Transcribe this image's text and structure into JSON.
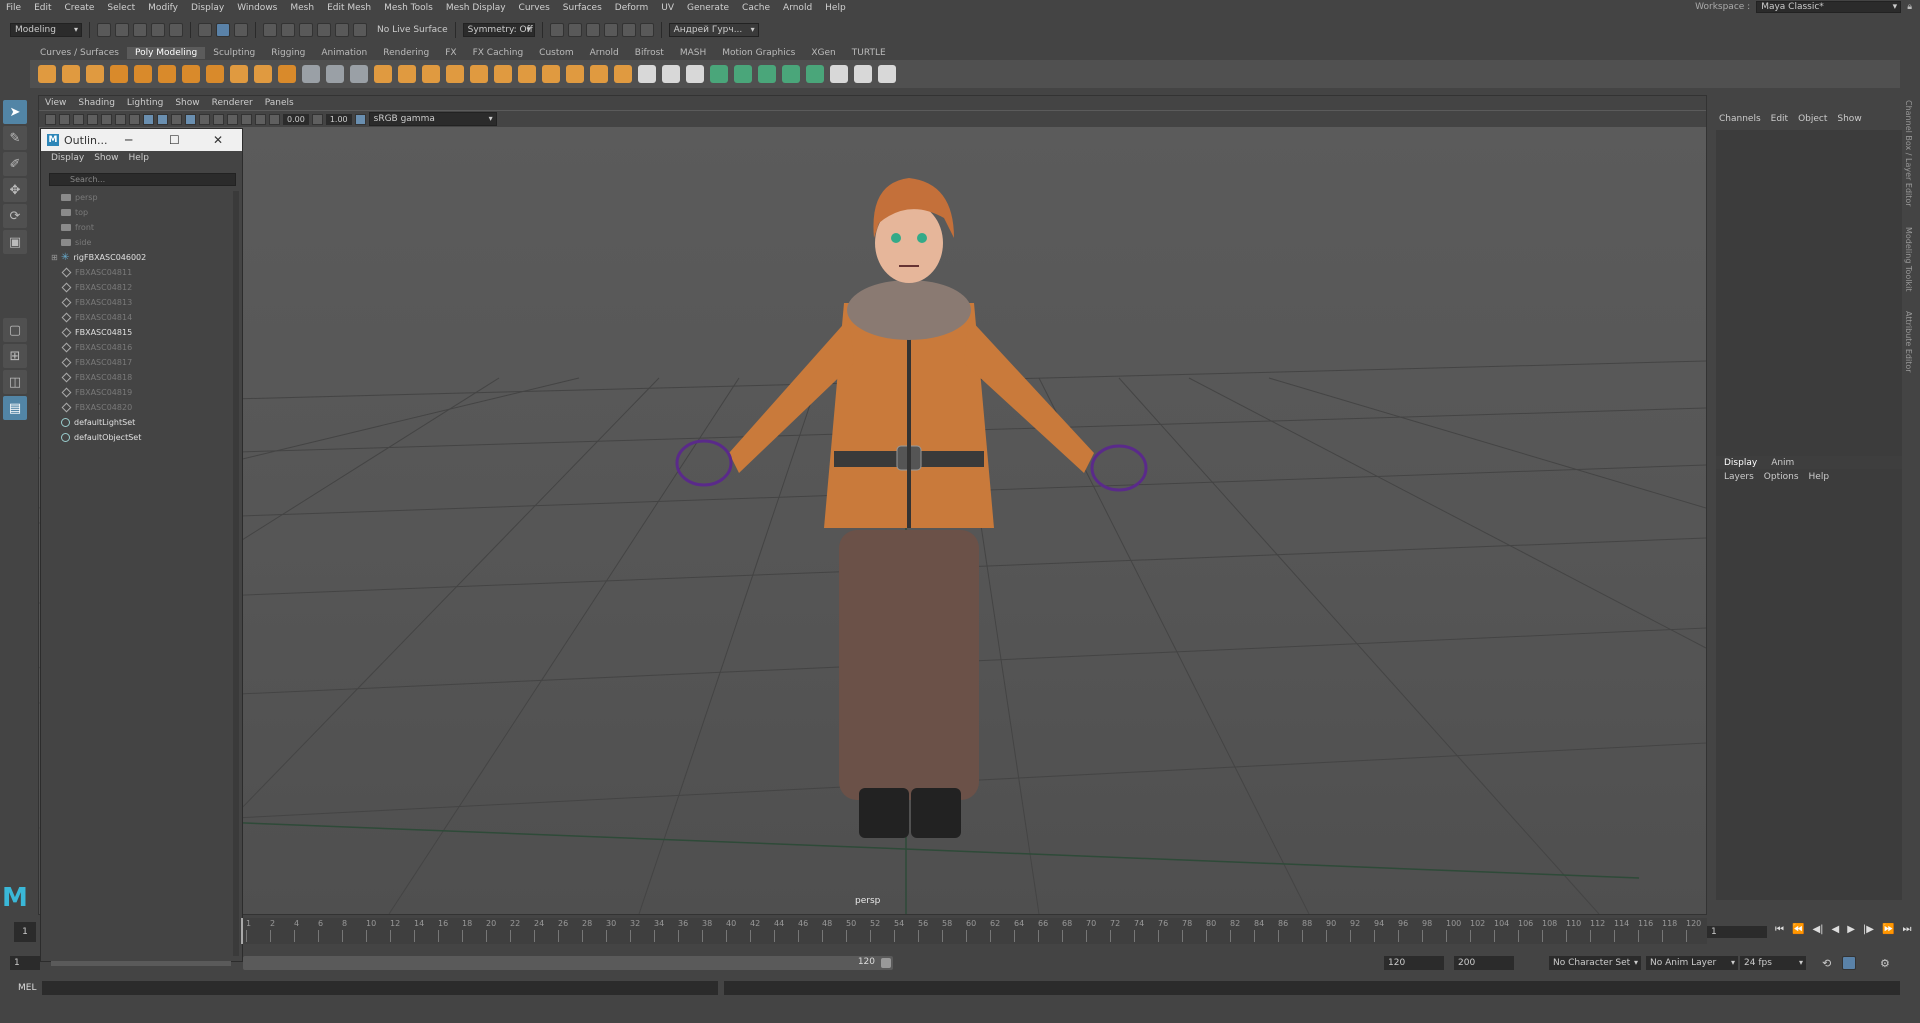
{
  "menubar": {
    "items": [
      "File",
      "Edit",
      "Create",
      "Select",
      "Modify",
      "Display",
      "Windows",
      "Mesh",
      "Edit Mesh",
      "Mesh Tools",
      "Mesh Display",
      "Curves",
      "Surfaces",
      "Deform",
      "UV",
      "Generate",
      "Cache",
      "Arnold",
      "Help"
    ]
  },
  "workspace": {
    "label": "Workspace :",
    "value": "Maya Classic*"
  },
  "statusline": {
    "mode": "Modeling",
    "live_surface": "No Live Surface",
    "symmetry": "Symmetry: Off",
    "user": "Андрей Гурч..."
  },
  "shelf": {
    "tabs": [
      "Curves / Surfaces",
      "Poly Modeling",
      "Sculpting",
      "Rigging",
      "Animation",
      "Rendering",
      "FX",
      "FX Caching",
      "Custom",
      "Arnold",
      "Bifrost",
      "MASH",
      "Motion Graphics",
      "XGen",
      "TURTLE"
    ],
    "active_tab": "Poly Modeling"
  },
  "viewport": {
    "menu": [
      "View",
      "Shading",
      "Lighting",
      "Show",
      "Renderer",
      "Panels"
    ],
    "exposure": "0.00",
    "gamma": "1.00",
    "color_space": "sRGB gamma",
    "camera_label": "persp"
  },
  "outliner": {
    "title": "Outlin...",
    "menu": [
      "Display",
      "Show",
      "Help"
    ],
    "search_placeholder": "Search...",
    "items": [
      {
        "label": "persp",
        "type": "cam",
        "bright": false,
        "expand": ""
      },
      {
        "label": "top",
        "type": "cam",
        "bright": false,
        "expand": ""
      },
      {
        "label": "front",
        "type": "cam",
        "bright": false,
        "expand": ""
      },
      {
        "label": "side",
        "type": "cam",
        "bright": false,
        "expand": ""
      },
      {
        "label": "rigFBXASC046002",
        "type": "rig",
        "bright": true,
        "expand": "⊞"
      },
      {
        "label": "FBXASC04811",
        "type": "mesh",
        "bright": false,
        "expand": ""
      },
      {
        "label": "FBXASC04812",
        "type": "mesh",
        "bright": false,
        "expand": ""
      },
      {
        "label": "FBXASC04813",
        "type": "mesh",
        "bright": false,
        "expand": ""
      },
      {
        "label": "FBXASC04814",
        "type": "mesh",
        "bright": false,
        "expand": ""
      },
      {
        "label": "FBXASC04815",
        "type": "mesh",
        "bright": true,
        "expand": ""
      },
      {
        "label": "FBXASC04816",
        "type": "mesh",
        "bright": false,
        "expand": ""
      },
      {
        "label": "FBXASC04817",
        "type": "mesh",
        "bright": false,
        "expand": ""
      },
      {
        "label": "FBXASC04818",
        "type": "mesh",
        "bright": false,
        "expand": ""
      },
      {
        "label": "FBXASC04819",
        "type": "mesh",
        "bright": false,
        "expand": ""
      },
      {
        "label": "FBXASC04820",
        "type": "mesh",
        "bright": false,
        "expand": ""
      },
      {
        "label": "defaultLightSet",
        "type": "set",
        "bright": true,
        "expand": ""
      },
      {
        "label": "defaultObjectSet",
        "type": "set",
        "bright": true,
        "expand": ""
      }
    ]
  },
  "channelbox": {
    "menu": [
      "Channels",
      "Edit",
      "Object",
      "Show"
    ],
    "layer_tabs": [
      "Display",
      "Anim"
    ],
    "active_layer_tab": "Display",
    "layer_menu": [
      "Layers",
      "Options",
      "Help"
    ]
  },
  "side_tabs": [
    "Channel Box / Layer Editor",
    "Modeling Toolkit",
    "Attribute Editor"
  ],
  "timeline": {
    "ticks": [
      "1",
      "2",
      "4",
      "6",
      "8",
      "10",
      "12",
      "14",
      "16",
      "18",
      "20",
      "22",
      "24",
      "26",
      "28",
      "30",
      "32",
      "34",
      "36",
      "38",
      "40",
      "42",
      "44",
      "46",
      "48",
      "50",
      "52",
      "54",
      "56",
      "58",
      "60",
      "62",
      "64",
      "66",
      "68",
      "70",
      "72",
      "74",
      "76",
      "78",
      "80",
      "82",
      "84",
      "86",
      "88",
      "90",
      "92",
      "94",
      "96",
      "98",
      "100",
      "102",
      "104",
      "106",
      "108",
      "110",
      "112",
      "114",
      "116",
      "118",
      "120"
    ],
    "current_frame": "1",
    "left_frame": "1"
  },
  "range": {
    "start": "1",
    "slider_end": "120",
    "end": "120",
    "anim_end": "200",
    "character_set": "No Character Set",
    "anim_layer": "No Anim Layer",
    "fps": "24 fps"
  },
  "commandline": {
    "label": "MEL"
  },
  "colors": {
    "accent": "#5285a6",
    "maya_logo": "#3ab8d8",
    "shelf_icon": "#e09a40"
  }
}
